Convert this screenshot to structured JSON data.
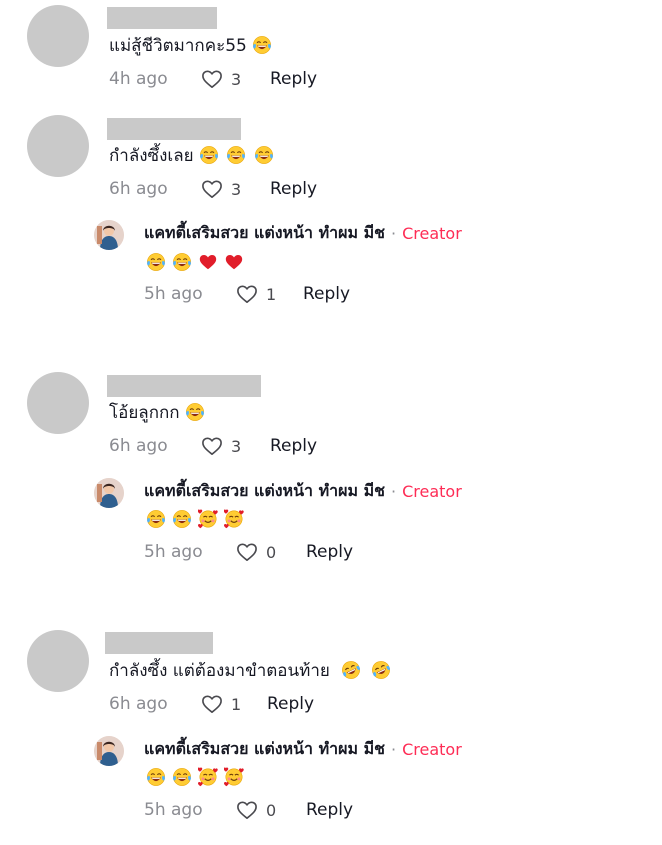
{
  "comments": [
    {
      "text": "แม่สู้ชีวิตมากคะ55",
      "trailing_emojis": [
        "joy"
      ],
      "time": "4h ago",
      "likes": "3",
      "reply_label": "Reply"
    },
    {
      "text": "กำลังซึ้งเลย",
      "trailing_emojis": [
        "joy",
        "joy",
        "joy"
      ],
      "time": "6h ago",
      "likes": "3",
      "reply_label": "Reply",
      "creator_reply": {
        "name": "แคทตี้เสริมสวย แต่งหน้า ทำผม มีช",
        "separator": "·",
        "tag": "Creator",
        "emojis": [
          "joy",
          "joy",
          "red-heart",
          "red-heart"
        ],
        "time": "5h ago",
        "likes": "1",
        "reply_label": "Reply"
      }
    },
    {
      "text": "โอ้ยลูกกก",
      "trailing_emojis": [
        "joy"
      ],
      "time": "6h ago",
      "likes": "3",
      "reply_label": "Reply",
      "creator_reply": {
        "name": "แคทตี้เสริมสวย แต่งหน้า ทำผม มีช",
        "separator": "·",
        "tag": "Creator",
        "emojis": [
          "joy",
          "joy",
          "smiling-hearts",
          "smiling-hearts"
        ],
        "time": "5h ago",
        "likes": "0",
        "reply_label": "Reply"
      }
    },
    {
      "text": "กำลังซึ้ง แต่ต้องมาขำตอนท้าย",
      "trailing_emojis": [
        "rofl",
        "rofl"
      ],
      "time": "6h ago",
      "likes": "1",
      "reply_label": "Reply",
      "creator_reply": {
        "name": "แคทตี้เสริมสวย แต่งหน้า ทำผม มีช",
        "separator": "·",
        "tag": "Creator",
        "emojis": [
          "joy",
          "joy",
          "smiling-hearts",
          "smiling-hearts"
        ],
        "time": "5h ago",
        "likes": "0",
        "reply_label": "Reply"
      }
    }
  ],
  "icons": {
    "like": "heart-outline-icon"
  },
  "colors": {
    "creator_tag": "#fe2c55",
    "meta_gray": "#8a8b91",
    "placeholder_gray": "#c9c9c9"
  }
}
